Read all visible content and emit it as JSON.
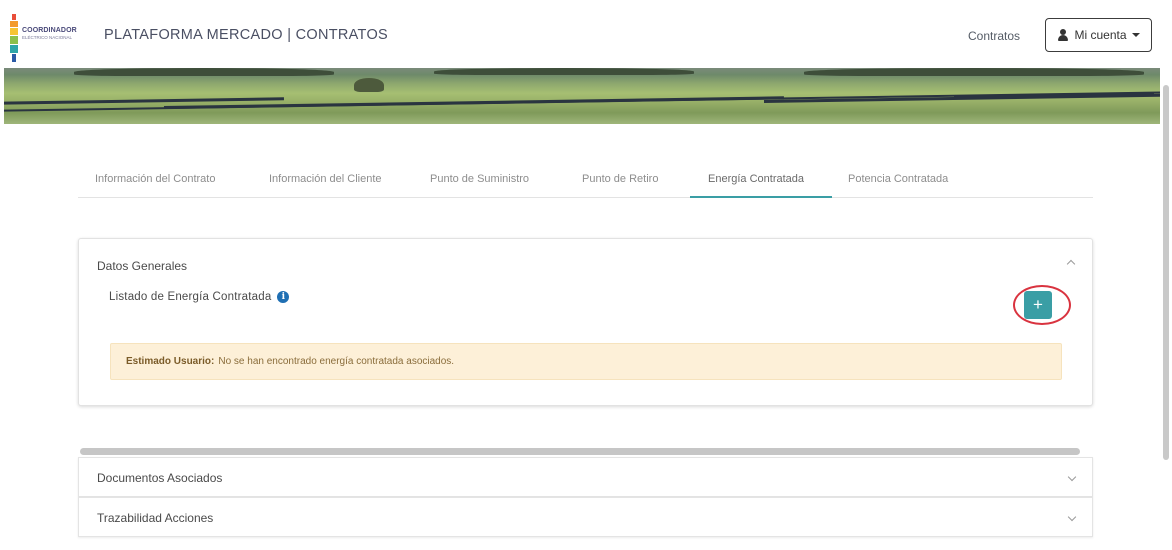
{
  "header": {
    "logo_text": "COORDINADOR",
    "logo_subtext": "ELÉCTRICO NACIONAL",
    "app_title": "PLATAFORMA MERCADO | CONTRATOS",
    "nav_contratos": "Contratos",
    "account_label": "Mi cuenta",
    "account_icon": "user-icon"
  },
  "tabs": [
    {
      "label": "Información del Contrato"
    },
    {
      "label": "Información del Cliente"
    },
    {
      "label": "Punto de Suministro"
    },
    {
      "label": "Punto de Retiro"
    },
    {
      "label": "Energía Contratada"
    },
    {
      "label": "Potencia Contratada"
    }
  ],
  "active_tab": "Energía Contratada",
  "datos_generales": {
    "title": "Datos Generales",
    "list_label": "Listado de Energía Contratada",
    "add_label": "+",
    "alert_strong": "Estimado Usuario:",
    "alert_text": "No se han encontrado energía contratada asociados."
  },
  "sections": [
    {
      "title": "Documentos Asociados"
    },
    {
      "title": "Trazabilidad Acciones"
    }
  ],
  "colors": {
    "accent": "#3a9ea5",
    "highlight_ring": "#d9333f",
    "alert_bg": "#fdf0d8",
    "info": "#1f6fb3"
  }
}
